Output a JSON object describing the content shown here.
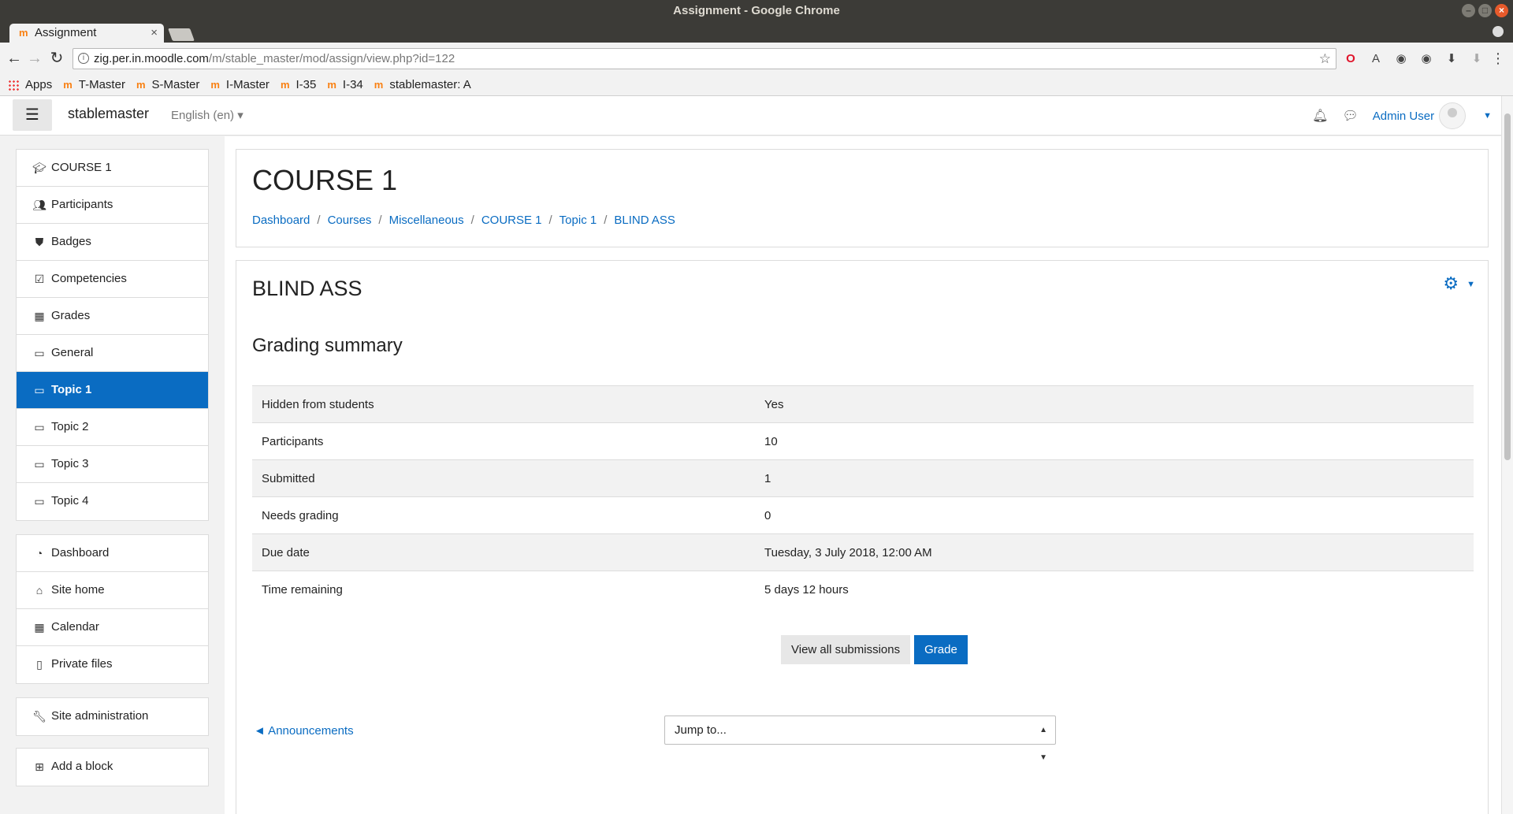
{
  "window": {
    "title": "Assignment - Google Chrome"
  },
  "browser": {
    "tab_title": "Assignment",
    "tab_favicon": "m",
    "url_host": "zig.per.in.moodle.com",
    "url_path": "/m/stable_master/mod/assign/view.php?id=122",
    "bookmarks": [
      {
        "label": "Apps"
      },
      {
        "label": "T-Master"
      },
      {
        "label": "S-Master"
      },
      {
        "label": "I-Master"
      },
      {
        "label": "I-35"
      },
      {
        "label": "I-34"
      },
      {
        "label": "stablemaster: A"
      }
    ]
  },
  "navbar": {
    "brand": "stablemaster",
    "language": "English (en)",
    "user": "Admin User"
  },
  "drawer": {
    "course_items": [
      {
        "label": "COURSE 1",
        "icon": "graduation-cap-icon"
      },
      {
        "label": "Participants",
        "icon": "users-icon"
      },
      {
        "label": "Badges",
        "icon": "shield-icon"
      },
      {
        "label": "Competencies",
        "icon": "checkbox-icon"
      },
      {
        "label": "Grades",
        "icon": "table-icon"
      },
      {
        "label": "General",
        "icon": "folder-icon"
      },
      {
        "label": "Topic 1",
        "icon": "folder-icon",
        "active": true
      },
      {
        "label": "Topic 2",
        "icon": "folder-icon"
      },
      {
        "label": "Topic 3",
        "icon": "folder-icon"
      },
      {
        "label": "Topic 4",
        "icon": "folder-icon"
      }
    ],
    "site_items": [
      {
        "label": "Dashboard",
        "icon": "dashboard-icon"
      },
      {
        "label": "Site home",
        "icon": "home-icon"
      },
      {
        "label": "Calendar",
        "icon": "calendar-icon"
      },
      {
        "label": "Private files",
        "icon": "file-icon"
      }
    ],
    "admin_item": {
      "label": "Site administration",
      "icon": "wrench-icon"
    },
    "block_item": {
      "label": "Add a block",
      "icon": "plus-square-icon"
    }
  },
  "header": {
    "course_title": "COURSE 1",
    "breadcrumb": [
      "Dashboard",
      "Courses",
      "Miscellaneous",
      "COURSE 1",
      "Topic 1",
      "BLIND ASS"
    ]
  },
  "activity": {
    "title": "BLIND ASS",
    "section_title": "Grading summary",
    "summary_rows": [
      {
        "label": "Hidden from students",
        "value": "Yes"
      },
      {
        "label": "Participants",
        "value": "10"
      },
      {
        "label": "Submitted",
        "value": "1"
      },
      {
        "label": "Needs grading",
        "value": "0"
      },
      {
        "label": "Due date",
        "value": "Tuesday, 3 July 2018, 12:00 AM"
      },
      {
        "label": "Time remaining",
        "value": "5 days 12 hours"
      }
    ],
    "buttons": {
      "view_all": "View all submissions",
      "grade": "Grade"
    },
    "prev_activity": "◄ Announcements",
    "jump_to": "Jump to..."
  },
  "colors": {
    "accent": "#0a6cc2",
    "moodle_orange": "#f98012"
  }
}
